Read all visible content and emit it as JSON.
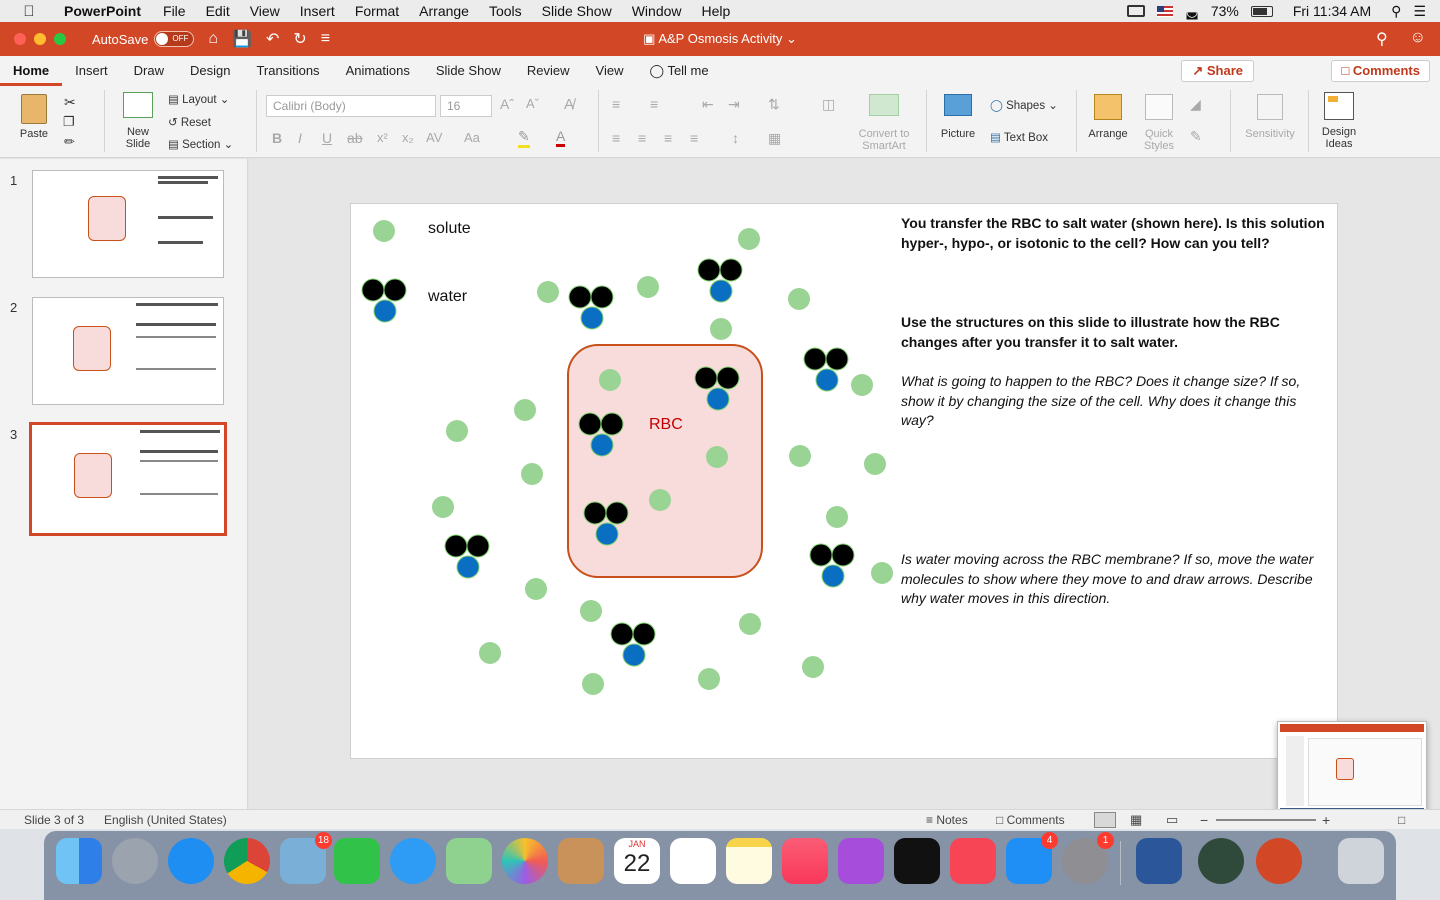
{
  "menubar": {
    "app": "PowerPoint",
    "items": [
      "File",
      "Edit",
      "View",
      "Insert",
      "Format",
      "Arrange",
      "Tools",
      "Slide Show",
      "Window",
      "Help"
    ],
    "battery": "73%",
    "clock": "Fri 11:34 AM"
  },
  "titlebar": {
    "autosave": "AutoSave",
    "autosave_state": "OFF",
    "doc_title": "A&P Osmosis Activity"
  },
  "tabs": [
    "Home",
    "Insert",
    "Draw",
    "Design",
    "Transitions",
    "Animations",
    "Slide Show",
    "Review",
    "View"
  ],
  "tell_me": "Tell me",
  "share": "Share",
  "comments": "Comments",
  "ribbon": {
    "paste": "Paste",
    "new_slide_1": "New",
    "new_slide_2": "Slide",
    "layout": "Layout",
    "reset": "Reset",
    "section": "Section",
    "font_name": "Calibri (Body)",
    "font_size": "16",
    "convert_1": "Convert to",
    "convert_2": "SmartArt",
    "picture": "Picture",
    "shapes": "Shapes",
    "text_box": "Text Box",
    "arrange": "Arrange",
    "quick_1": "Quick",
    "quick_2": "Styles",
    "sensitivity": "Sensitivity",
    "design_1": "Design",
    "design_2": "Ideas"
  },
  "thumbnails": [
    "1",
    "2",
    "3"
  ],
  "slide": {
    "solute_label": "solute",
    "water_label": "water",
    "rbc_label": "RBC",
    "q1": "You transfer the RBC to salt water (shown here). Is this solution hyper-, hypo-, or isotonic to the cell? How can you tell?",
    "q2": "Use the structures on this slide to illustrate how the RBC changes after you transfer it to salt water.",
    "q3": "What is going to happen to the RBC? Does it change size? If so, show it by changing the size of the cell. Why does it change this way?",
    "q4": "Is water moving across the RBC membrane? If so, move the water molecules to show where they move to and draw arrows. Describe why water moves in this direction."
  },
  "status": {
    "slide_count": "Slide 3 of 3",
    "language": "English (United States)",
    "notes": "Notes",
    "comments": "Comments"
  },
  "dock": {
    "mail_badge": "18",
    "appstore_badge": "4",
    "prefs_badge": "1",
    "calendar_month": "JAN",
    "calendar_day": "22"
  },
  "colors": {
    "accent": "#d24726",
    "solute": "#9ad495",
    "water_o": "#000000",
    "water_h": "#0a6fc2",
    "rbc_fill": "#f8dcdc",
    "rbc_border": "#c8501a",
    "rbc_text": "#c00000"
  }
}
